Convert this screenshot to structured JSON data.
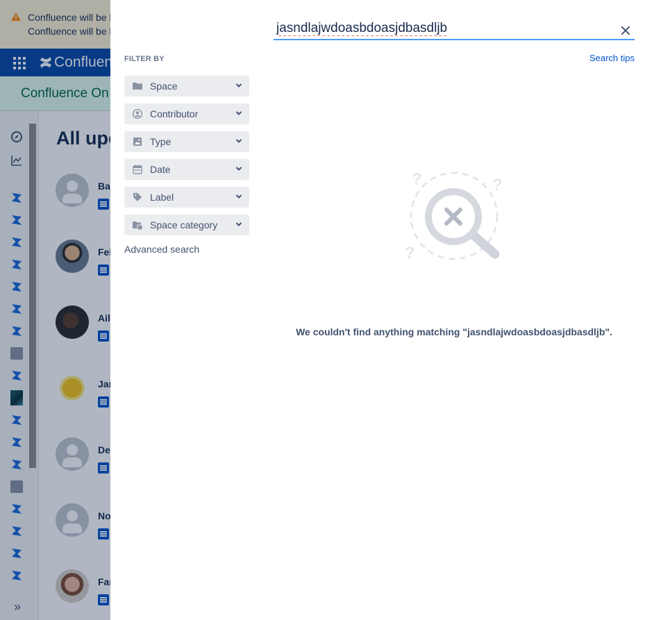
{
  "background_app": {
    "banner_lines": [
      "Confluence will be l",
      "Confluence will be l"
    ],
    "brand": "Confluen",
    "promo": "Confluence On",
    "page_title": "All upo",
    "feed_names": [
      "Bay",
      "Fel",
      "Ail",
      "Jan",
      "De",
      "No",
      "Far"
    ]
  },
  "search": {
    "query": "jasndlajwdoasbdoasjdbasdljb",
    "filter_heading": "FILTER BY",
    "search_tips": "Search tips",
    "filters": [
      {
        "label": "Space",
        "icon": "folder-icon"
      },
      {
        "label": "Contributor",
        "icon": "person-icon"
      },
      {
        "label": "Type",
        "icon": "image-icon"
      },
      {
        "label": "Date",
        "icon": "calendar-icon"
      },
      {
        "label": "Label",
        "icon": "tag-icon"
      },
      {
        "label": "Space category",
        "icon": "folder-category-icon"
      }
    ],
    "advanced_search": "Advanced search",
    "no_results": "We couldn't find anything matching \"jasndlajwdoasbdoasjdbasdljb\"."
  },
  "colors": {
    "brand_blue": "#0747a6",
    "link_blue": "#0052cc",
    "focus_blue": "#4c9aff",
    "banner_yellow": "#fff4d6",
    "promo_green": "#e3fcef",
    "filter_bg": "#ebecf0",
    "text_secondary": "#42526e"
  }
}
